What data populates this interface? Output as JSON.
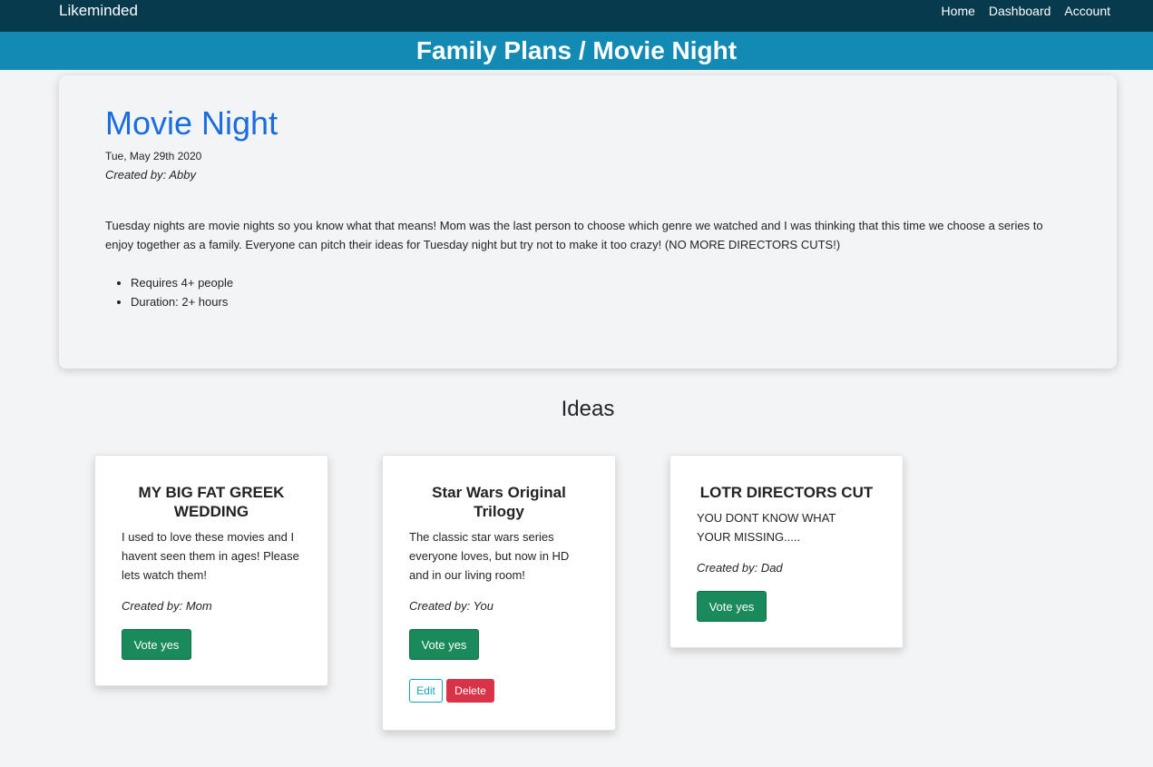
{
  "nav": {
    "brand": "Likeminded",
    "links": [
      "Home",
      "Dashboard",
      "Account"
    ]
  },
  "breadcrumb": "Family Plans / Movie Night",
  "plan": {
    "title": "Movie Night",
    "date": "Tue, May 29th 2020",
    "created_by": "Created by: Abby",
    "description": "Tuesday nights are movie nights so you know what that means! Mom was the last person to choose which genre we watched and I was thinking that this time we choose a series to enjoy together as a family. Everyone can pitch their ideas for Tuesday night but try not to make it too crazy! (NO MORE DIRECTORS CUTS!)",
    "requirements": [
      "Requires 4+ people",
      "Duration: 2+ hours"
    ]
  },
  "ideas": {
    "heading": "Ideas",
    "items": [
      {
        "title": "MY BIG FAT GREEK WEDDING",
        "description": "I used to love these movies and I havent seen them in ages! Please lets watch them!",
        "created_by": "Created by: Mom",
        "vote_label": "Vote yes"
      },
      {
        "title": "Star Wars Original Trilogy",
        "description": "The classic star wars series everyone loves, but now in HD and in our living room!",
        "created_by": "Created by: You",
        "vote_label": "Vote yes",
        "edit_label": "Edit",
        "delete_label": "Delete"
      },
      {
        "title": "LOTR DIRECTORS CUT",
        "description": "YOU DONT KNOW WHAT YOUR MISSING.....",
        "created_by": "Created by: Dad",
        "vote_label": "Vote yes"
      }
    ]
  },
  "colors": {
    "navbar": "#063a4c",
    "breadcrumb_bar": "#128ab3",
    "plan_title": "#1a6de1",
    "vote_button": "#1a8a5a",
    "edit_button": "#17a2b8",
    "delete_button": "#d9334a"
  }
}
